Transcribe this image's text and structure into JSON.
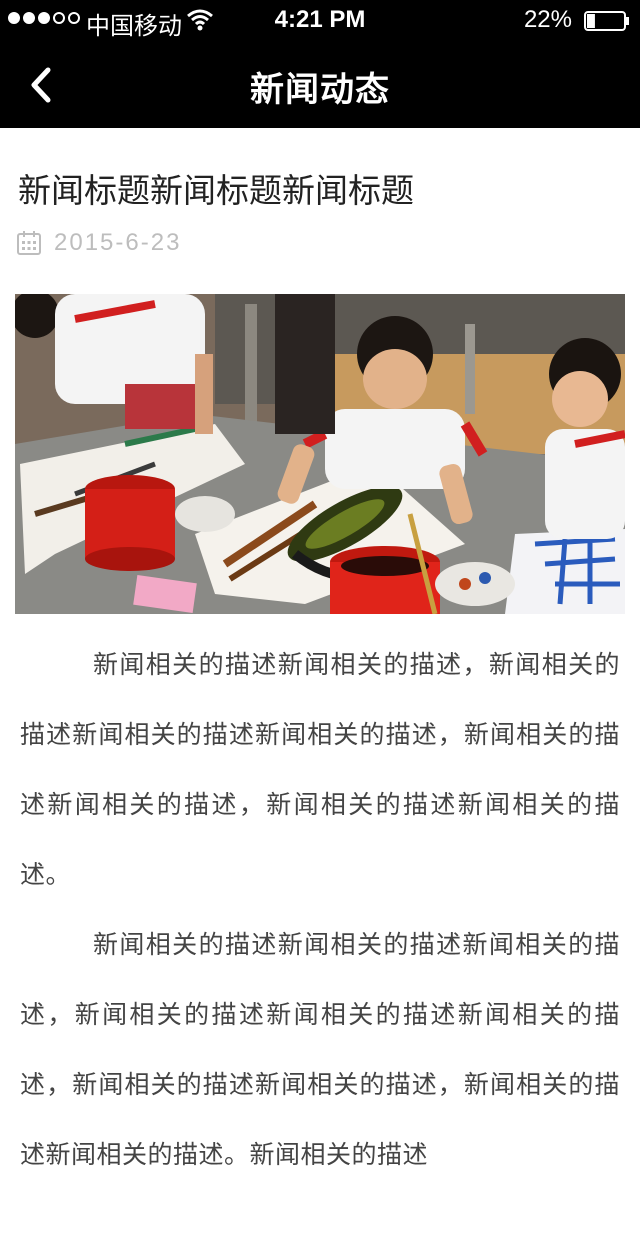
{
  "status_bar": {
    "carrier": "中国移动",
    "time": "4:21 PM",
    "battery_percent": "22%",
    "signal_bars_filled": 3,
    "signal_bars_total": 5,
    "battery_level": 0.22
  },
  "nav": {
    "title": "新闻动态",
    "back_icon": "chevron-left-icon"
  },
  "article": {
    "title": "新闻标题新闻标题新闻标题",
    "date": "2015-6-23",
    "date_icon": "calendar-icon",
    "paragraphs": [
      "新闻相关的描述新闻相关的描述，新闻相关的描述新闻相关的描述新闻相关的描述，新闻相关的描述新闻相关的描述，新闻相关的描述新闻相关的描述。",
      "新闻相关的描述新闻相关的描述新闻相关的描述，新闻相关的描述新闻相关的描述新闻相关的描述，新闻相关的描述新闻相关的描述，新闻相关的描述新闻相关的描述。新闻相关的描述"
    ]
  },
  "colors": {
    "header_bg": "#000000",
    "header_text": "#ffffff",
    "meta_gray": "#bdbdbd",
    "body_text": "#444444"
  }
}
